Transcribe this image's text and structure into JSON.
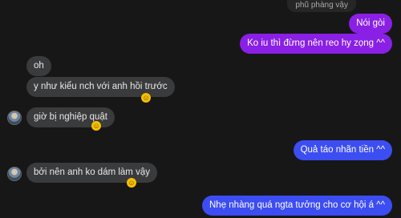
{
  "messages": {
    "quote": "phũ phàng vậy",
    "m1": "Nói gòi",
    "m2": "Ko iu thì đừng nên reo hy zọng ^^",
    "m3": "oh",
    "m4": "y như kiểu nch với anh hồi trước",
    "m5": "giờ bị nghiệp quật",
    "m6": "Quả táo nhãn tiền ^^",
    "m7": "bởi nên anh ko dám làm vậy",
    "m8": "Nhẹ nhàng quá ngta tưởng cho cơ hội á ^^"
  },
  "colors": {
    "outgoing_purple": "#8a1fe6",
    "outgoing_blue": "#3c4df2",
    "incoming": "#3a3b3c",
    "background": "#171717"
  }
}
